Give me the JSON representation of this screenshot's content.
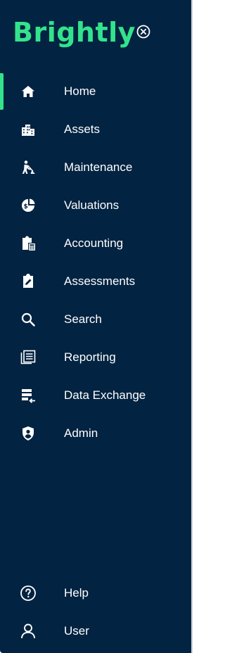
{
  "app": {
    "logo_text": "Brightly"
  },
  "header": {
    "close_icon": "close-circle-icon"
  },
  "nav": {
    "items": [
      {
        "label": "Home",
        "icon": "home-icon",
        "active": true
      },
      {
        "label": "Assets",
        "icon": "buildings-icon",
        "active": false
      },
      {
        "label": "Maintenance",
        "icon": "worker-digging-icon",
        "active": false
      },
      {
        "label": "Valuations",
        "icon": "dollar-pie-icon",
        "active": false
      },
      {
        "label": "Accounting",
        "icon": "clipboard-calculator-icon",
        "active": false
      },
      {
        "label": "Assessments",
        "icon": "clipboard-edit-icon",
        "active": false
      },
      {
        "label": "Search",
        "icon": "search-icon",
        "active": false
      },
      {
        "label": "Reporting",
        "icon": "report-stack-icon",
        "active": false
      },
      {
        "label": "Data Exchange",
        "icon": "data-import-icon",
        "active": false
      },
      {
        "label": "Admin",
        "icon": "shield-user-icon",
        "active": false
      }
    ]
  },
  "footer": {
    "items": [
      {
        "label": "Help",
        "icon": "help-circle-icon"
      },
      {
        "label": "User",
        "icon": "user-icon"
      }
    ]
  },
  "colors": {
    "sidebar_bg": "#022341",
    "accent": "#33e38c",
    "text": "#ffffff"
  }
}
